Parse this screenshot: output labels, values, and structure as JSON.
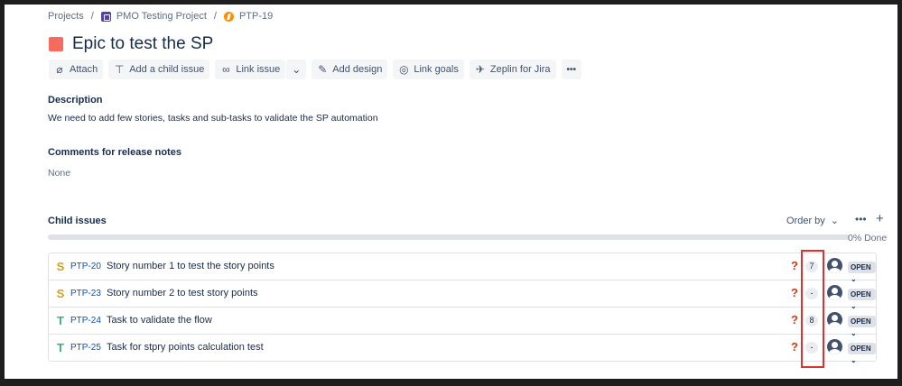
{
  "breadcrumb": {
    "projects": "Projects",
    "sep1": "/",
    "project": "PMO Testing Project",
    "sep2": "/",
    "parent_key": "PTP-19"
  },
  "issue": {
    "title": "Epic to test the SP"
  },
  "toolbar": {
    "attach": "Attach",
    "add_child": "Add a child issue",
    "link_issue": "Link issue",
    "add_design": "Add design",
    "link_goals": "Link goals",
    "zeplin": "Zeplin for Jira",
    "more": "•••"
  },
  "description": {
    "label": "Description",
    "text": "We need to add few stories, tasks and sub-tasks to validate the SP automation"
  },
  "release_notes": {
    "label": "Comments for release notes",
    "value": "None"
  },
  "child_issues": {
    "label": "Child issues",
    "order_by": "Order by",
    "more": "•••",
    "add": "+",
    "progress_text": "0% Done",
    "progress": 0,
    "items": [
      {
        "type_icon": "story-icon",
        "type_glyph": "S",
        "key": "PTP-20",
        "summary": "Story number 1 to test the story points",
        "priority_glyph": "?",
        "story_points": "7",
        "status": "OPEN"
      },
      {
        "type_icon": "story-icon",
        "type_glyph": "S",
        "key": "PTP-23",
        "summary": "Story number 2 to test story points",
        "priority_glyph": "?",
        "story_points": "-",
        "status": "OPEN"
      },
      {
        "type_icon": "task-icon",
        "type_glyph": "T",
        "key": "PTP-24",
        "summary": "Task to validate the flow",
        "priority_glyph": "?",
        "story_points": "8",
        "status": "OPEN"
      },
      {
        "type_icon": "task-icon",
        "type_glyph": "T",
        "key": "PTP-25",
        "summary": "Task for stpry points calculation test",
        "priority_glyph": "?",
        "story_points": "-",
        "status": "OPEN"
      }
    ]
  },
  "colors": {
    "epic": "#F66B5D",
    "link": "#0052CC",
    "highlight": "#E03131"
  }
}
